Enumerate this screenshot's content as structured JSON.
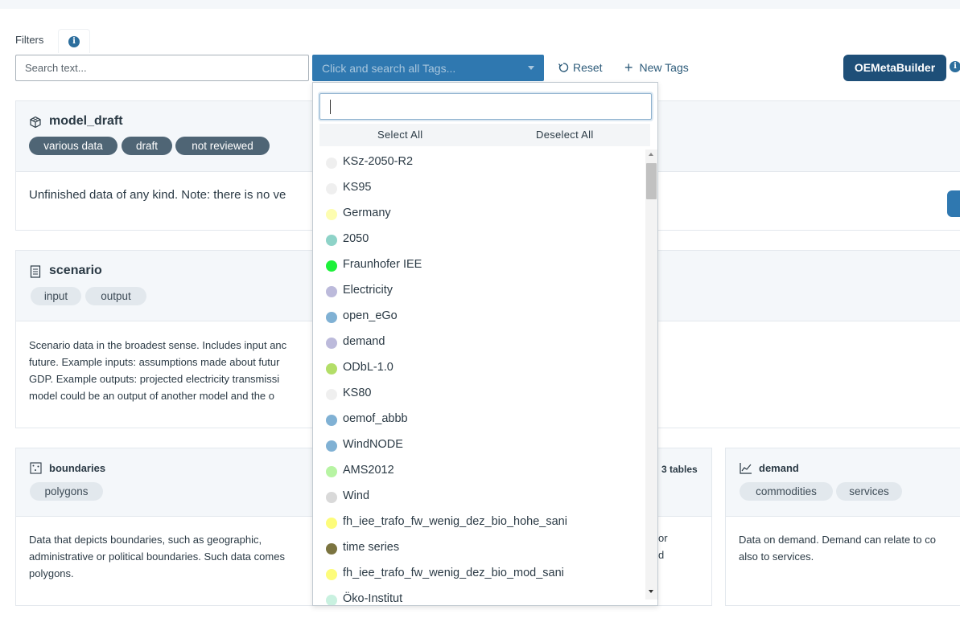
{
  "filters": {
    "label": "Filters",
    "info_glyph": "i",
    "search_placeholder": "Search text...",
    "tags_placeholder": "Click and search all Tags...",
    "reset_label": "Reset",
    "new_tags_label": "New Tags",
    "oemetabuilder_label": "OEMetaBuilder"
  },
  "cards": {
    "model_draft": {
      "title": "model_draft",
      "icon": "cube-icon",
      "tags": [
        "various data",
        "draft",
        "not reviewed"
      ],
      "description": "Unfinished data of any kind. Note: there is no ve"
    },
    "scenario": {
      "title": "scenario",
      "icon": "document-icon",
      "tags": [
        "input",
        "output"
      ],
      "description_lines": [
        "Scenario data in the broadest sense. Includes input anc",
        "future. Example inputs: assumptions made about futur",
        "GDP. Example outputs: projected electricity transmissi",
        "model could be an output of another model and the o"
      ]
    },
    "boundaries": {
      "title": "boundaries",
      "icon": "boundaries-icon",
      "tags": [
        "polygons"
      ],
      "description_lines": [
        "Data that depicts boundaries, such as geographic,",
        "administrative or political boundaries. Such data comes",
        "polygons."
      ]
    },
    "middle_partial": {
      "tables_count": "3 tables",
      "description_fragments": [
        "or",
        "d"
      ]
    },
    "demand": {
      "title": "demand",
      "icon": "line-chart-icon",
      "tags": [
        "commodities",
        "services"
      ],
      "description_lines": [
        "Data on demand. Demand can relate to co",
        "also to services."
      ]
    }
  },
  "dropdown": {
    "select_all": "Select All",
    "deselect_all": "Deselect All",
    "items": [
      {
        "label": "KSz-2050-R2",
        "color": "#efefef"
      },
      {
        "label": "KS95",
        "color": "#efefef"
      },
      {
        "label": "Germany",
        "color": "#fdfdb0"
      },
      {
        "label": "2050",
        "color": "#8ed3c8"
      },
      {
        "label": "Fraunhofer IEE",
        "color": "#1df13a"
      },
      {
        "label": "Electricity",
        "color": "#bcbadb"
      },
      {
        "label": "open_eGo",
        "color": "#80b1d4"
      },
      {
        "label": "demand",
        "color": "#bcbadb"
      },
      {
        "label": "ODbL-1.0",
        "color": "#b3de68"
      },
      {
        "label": "KS80",
        "color": "#efefef"
      },
      {
        "label": "oemof_abbb",
        "color": "#80b1d4"
      },
      {
        "label": "WindNODE",
        "color": "#80b1d4"
      },
      {
        "label": "AMS2012",
        "color": "#b7f4a3"
      },
      {
        "label": "Wind",
        "color": "#d9d9d9"
      },
      {
        "label": "fh_iee_trafo_fw_wenig_dez_bio_hohe_sani",
        "color": "#fdfc7a"
      },
      {
        "label": "time series",
        "color": "#7b7440"
      },
      {
        "label": "fh_iee_trafo_fw_wenig_dez_bio_mod_sani",
        "color": "#fdfc7a"
      },
      {
        "label": "Öko-Institut",
        "color": "#c9f1e0"
      }
    ]
  }
}
